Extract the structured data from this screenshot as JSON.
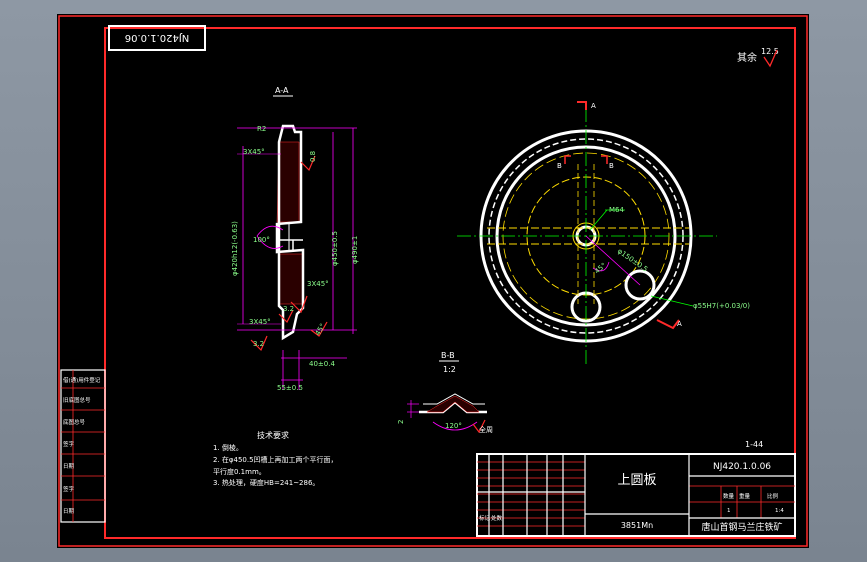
{
  "title_block": {
    "part_name": "上圆板",
    "drawing_number": "NJ420.1.0.06",
    "material": "3851Mn",
    "company": "唐山首钢马兰庄铁矿",
    "scale": "1:4",
    "scale_label": "比例",
    "quantity": "1",
    "quantity_label": "数量",
    "weight_label": "重量",
    "mark_label": "标记",
    "count_label": "处数",
    "sheet_ref": "1-44"
  },
  "rotated_stamp": "NJ420.1.0.06",
  "roughness_note": {
    "label": "其余",
    "value": "12.5"
  },
  "section_aa": {
    "label": "A-A",
    "dims": {
      "r2": "R2",
      "chamfer_top": "3X45°",
      "chamfer_mid": "3X45°",
      "chamfer_bot": "3X45°",
      "angle_100": "100°",
      "dia_rim": "φ490±1",
      "dia_main": "φ450±0.5",
      "dia_inner": "φ420h12(-0.63)",
      "thickness": "40±0.4",
      "overall": "55±0.5",
      "roughness_08": "0.8",
      "roughness_32a": "3.2",
      "roughness_32b": "3.2",
      "angle_45": "45°"
    }
  },
  "section_bb": {
    "label": "B-B",
    "scale": "1:2",
    "angle": "120°",
    "depth": "2",
    "note": "全周"
  },
  "plan_view": {
    "label_a_top": "A",
    "label_a_bottom": "A",
    "label_b_left": "B",
    "label_b_right": "B",
    "thread": "M64",
    "bolt_circle": "φ150±0.5",
    "angle": "45°",
    "bore": "φ55H7(+0.03/0)"
  },
  "tech_req": {
    "title": "技术要求",
    "lines": [
      "1. 倒棱。",
      "2. 在φ450.5凹槽上再加工两个平行面，",
      "平行度0.1mm。",
      "3. 热处理，硬度HB=241~286。"
    ]
  },
  "side_table": [
    "借(通)用件登记",
    "旧底图总号",
    "底图总号",
    "签字",
    "日期",
    "签字",
    "日期"
  ]
}
